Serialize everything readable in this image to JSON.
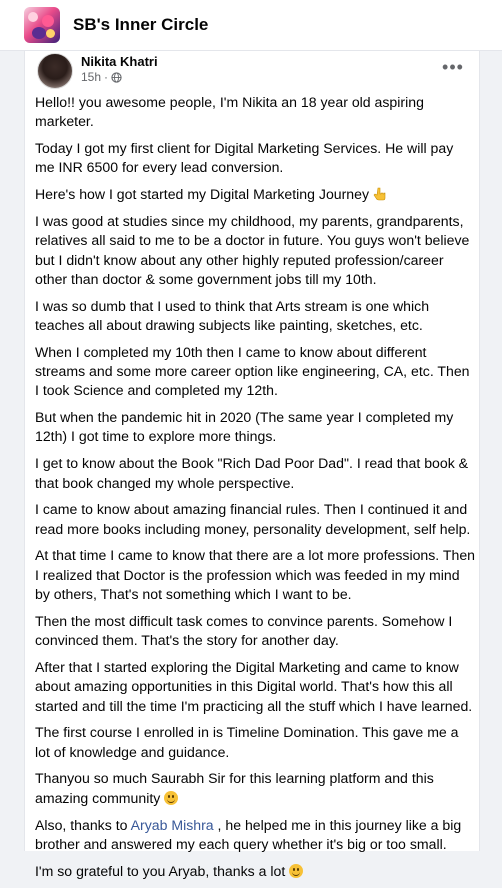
{
  "header": {
    "group_title": "SB's Inner Circle"
  },
  "post": {
    "author": "Nikita Khatri",
    "time": "15h",
    "privacy_icon": "globe-icon",
    "more_icon": "more-options-icon",
    "paragraphs": [
      "Hello!! you awesome people, I'm Nikita an 18 year old aspiring marketer.",
      "Today I got my first client for Digital Marketing Services. He will pay me INR 6500 for every lead conversion.",
      "Here's how I got started my Digital Marketing Journey",
      "I was good at studies since my childhood, my parents, grandparents, relatives all said to me to be a doctor in future. You guys won't believe but I didn't know about any other highly reputed profession/career other than doctor & some government jobs till my 10th.",
      "I was so dumb that I used to think that Arts stream is one which teaches all about drawing subjects like painting, sketches, etc.",
      "When I completed my 10th then I came to know about different streams and some more career option like engineering, CA, etc. Then I took Science and completed my 12th.",
      "But when the pandemic hit in 2020 (The same year I completed my 12th) I got time to explore more things.",
      "I get to know about the Book \"Rich Dad Poor Dad\". I read that book & that book changed my whole perspective.",
      "I came to know about amazing financial rules. Then I continued it and read more books including money, personality development, self help.",
      "At that time I came to know that there are a lot more professions. Then I realized that Doctor is the profession which was feeded in my mind by others, That's not something which I want to be.",
      "Then the most difficult task comes to convince parents. Somehow I convinced them. That's the story for another day.",
      "After that I started exploring the Digital Marketing and came to know about amazing opportunities in this Digital world. That's how this all started and till the time I'm practicing all the stuff which I have learned.",
      "The first course I enrolled in is Timeline Domination. This gave me a lot of knowledge and guidance.",
      "Thanyou so much Saurabh Sir for this learning platform and this amazing community"
    ],
    "thanks_prefix": "Also, thanks to ",
    "mention": "Aryab Mishra",
    "thanks_suffix": " , he helped me in this journey like a big brother and answered my each query whether it's big or too small.",
    "last_line": "I'm so grateful to you Aryab, thanks a lot"
  }
}
